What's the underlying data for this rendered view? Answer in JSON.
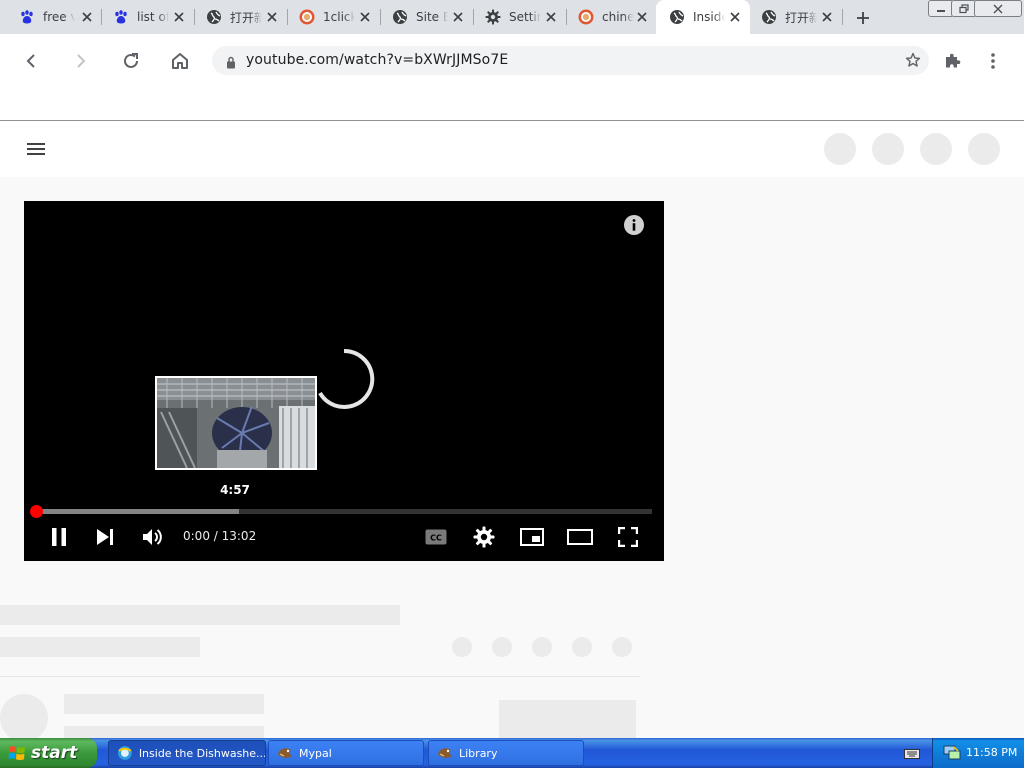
{
  "browser": {
    "tabs": [
      {
        "title": "free v",
        "icon": "baidu-paw-icon"
      },
      {
        "title": "list of",
        "icon": "baidu-paw-icon"
      },
      {
        "title": "打开新",
        "icon": "globe-icon"
      },
      {
        "title": "1click",
        "icon": "duckduckgo-icon"
      },
      {
        "title": "Site Bl",
        "icon": "globe-icon"
      },
      {
        "title": "Settin",
        "icon": "gear-icon"
      },
      {
        "title": "chines",
        "icon": "duckduckgo-icon"
      },
      {
        "title": "Inside",
        "icon": "globe-icon",
        "active": true
      },
      {
        "title": "打开新",
        "icon": "globe-icon"
      }
    ],
    "url": "youtube.com/watch?v=bXWrJJMSo7E"
  },
  "player": {
    "preview_time": "4:57",
    "current_time": "0:00",
    "duration": "13:02",
    "time_display": "0:00 / 13:02",
    "buffered_fraction": 0.33,
    "played_fraction": 0.0
  },
  "taskbar": {
    "start_label": "start",
    "items": [
      {
        "label": "Inside the Dishwashe...",
        "active": true
      },
      {
        "label": "Mypal"
      },
      {
        "label": "Library"
      }
    ],
    "clock": "11:58 PM"
  },
  "colors": {
    "tabstrip": "#dee1e6",
    "progress_red": "#ff0000",
    "taskbar_blue": "#2458d5",
    "start_green": "#3b9a3b"
  }
}
